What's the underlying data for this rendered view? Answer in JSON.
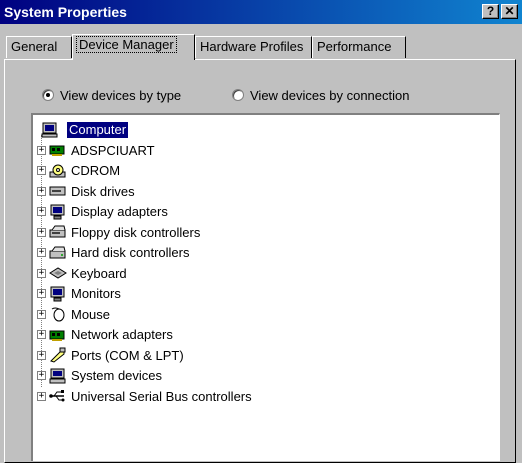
{
  "window": {
    "title": "System Properties",
    "help_button": "?",
    "close_button": "✕"
  },
  "tabs": [
    {
      "label": "General"
    },
    {
      "label": "Device Manager"
    },
    {
      "label": "Hardware Profiles"
    },
    {
      "label": "Performance"
    }
  ],
  "view_options": {
    "by_type": "View devices by type",
    "by_connection": "View devices by connection",
    "selected": "by_type"
  },
  "tree": {
    "root": "Computer",
    "items": [
      {
        "label": "ADSPCIUART",
        "icon": "network-card-icon"
      },
      {
        "label": "CDROM",
        "icon": "cdrom-icon"
      },
      {
        "label": "Disk drives",
        "icon": "disk-drive-icon"
      },
      {
        "label": "Display adapters",
        "icon": "monitor-icon"
      },
      {
        "label": "Floppy disk controllers",
        "icon": "floppy-controller-icon"
      },
      {
        "label": "Hard disk controllers",
        "icon": "hard-disk-controller-icon"
      },
      {
        "label": "Keyboard",
        "icon": "keyboard-icon"
      },
      {
        "label": "Monitors",
        "icon": "monitor-icon"
      },
      {
        "label": "Mouse",
        "icon": "mouse-icon"
      },
      {
        "label": "Network adapters",
        "icon": "network-card-icon"
      },
      {
        "label": "Ports (COM & LPT)",
        "icon": "port-icon"
      },
      {
        "label": "System devices",
        "icon": "computer-icon"
      },
      {
        "label": "Universal Serial Bus controllers",
        "icon": "usb-icon"
      }
    ]
  }
}
